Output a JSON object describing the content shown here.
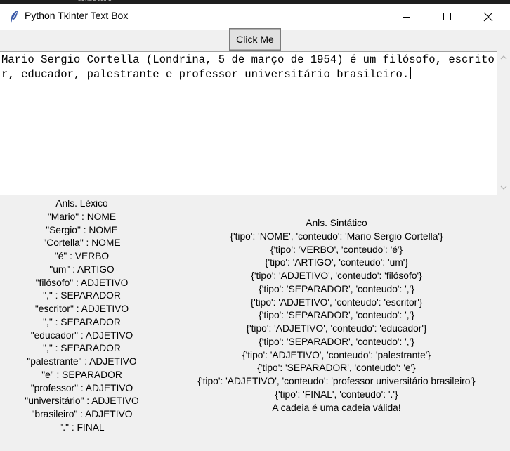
{
  "window": {
    "title": "Python Tkinter Text Box",
    "background_fragment": "consoleme"
  },
  "toolbar": {
    "click_label": "Click Me"
  },
  "textbox": {
    "content": "Mario Sergio Cortella (Londrina, 5 de março de 1954) é um filósofo, escritor, educador, palestrante e professor universitário brasileiro."
  },
  "lexico": {
    "heading": "Anls. Léxico",
    "lines": [
      "\"Mario\" : NOME",
      "\"Sergio\" : NOME",
      "\"Cortella\" : NOME",
      "\"é\" : VERBO",
      "\"um\" : ARTIGO",
      "\"filósofo\" : ADJETIVO",
      "\",\" : SEPARADOR",
      "\"escritor\" : ADJETIVO",
      "\",\" : SEPARADOR",
      "\"educador\" : ADJETIVO",
      "\",\" : SEPARADOR",
      "\"palestrante\" : ADJETIVO",
      "\"e\" : SEPARADOR",
      "\"professor\" : ADJETIVO",
      "\"universitário\" : ADJETIVO",
      "\"brasileiro\" : ADJETIVO",
      "\".\" : FINAL"
    ]
  },
  "sintatico": {
    "heading": "Anls. Sintático",
    "lines": [
      "{'tipo': 'NOME', 'conteudo': 'Mario Sergio Cortella'}",
      "{'tipo': 'VERBO', 'conteudo': 'é'}",
      "{'tipo': 'ARTIGO', 'conteudo': 'um'}",
      "{'tipo': 'ADJETIVO', 'conteudo': 'filósofo'}",
      "{'tipo': 'SEPARADOR', 'conteudo': ','}",
      "{'tipo': 'ADJETIVO', 'conteudo': 'escritor'}",
      "{'tipo': 'SEPARADOR', 'conteudo': ','}",
      "{'tipo': 'ADJETIVO', 'conteudo': 'educador'}",
      "{'tipo': 'SEPARADOR', 'conteudo': ','}",
      "{'tipo': 'ADJETIVO', 'conteudo': 'palestrante'}",
      "{'tipo': 'SEPARADOR', 'conteudo': 'e'}",
      "{'tipo': 'ADJETIVO', 'conteudo': 'professor universitário brasileiro'}",
      "{'tipo': 'FINAL', 'conteudo': '.'}"
    ],
    "result": "A cadeia é uma cadeia válida!"
  },
  "icons": {
    "app": "feather-icon",
    "minimize": "minimize-icon",
    "maximize": "maximize-icon",
    "close": "close-icon",
    "scroll_up": "chevron-up-icon",
    "scroll_down": "chevron-down-icon"
  },
  "colors": {
    "window_bg": "#f0f0f0",
    "titlebar_bg": "#ffffff",
    "button_bg": "#e1e1e1",
    "button_border": "#adadad",
    "text": "#000000",
    "feather": "#3b5aa8"
  }
}
